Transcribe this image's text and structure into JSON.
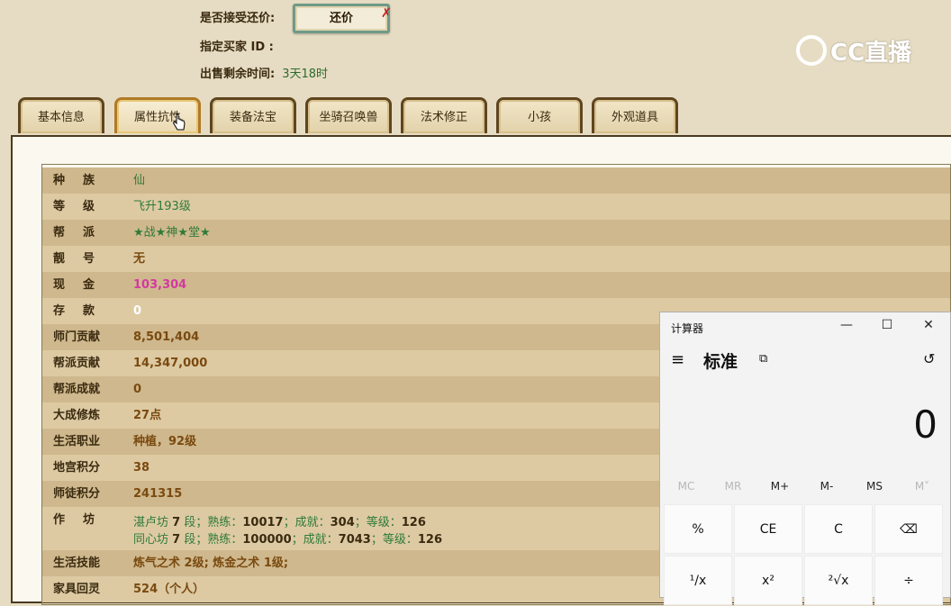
{
  "header": {
    "accept_counter_label": "是否接受还价:",
    "counter_button": "还价",
    "buyer_id_label": "指定买家 ID :",
    "time_left_label": "出售剩余时间:",
    "time_left_value": "3天18时"
  },
  "logo": {
    "text": "CC直播"
  },
  "tabs": [
    {
      "label": "基本信息"
    },
    {
      "label": "属性抗性"
    },
    {
      "label": "装备法宝"
    },
    {
      "label": "坐骑召唤兽"
    },
    {
      "label": "法术修正"
    },
    {
      "label": "小孩"
    },
    {
      "label": "外观道具"
    }
  ],
  "rows": [
    {
      "label": "种族",
      "value": "仙"
    },
    {
      "label": "等级",
      "value": "飞升193级"
    },
    {
      "label": "帮派",
      "value": "★战★神★堂★"
    },
    {
      "label": "靓号",
      "value": "无"
    },
    {
      "label": "现金",
      "value": "103,304"
    },
    {
      "label": "存款",
      "value": "0"
    },
    {
      "label": "师门贡献",
      "value": "8,501,404"
    },
    {
      "label": "帮派贡献",
      "value": "14,347,000"
    },
    {
      "label": "帮派成就",
      "value": "0"
    },
    {
      "label": "大成修炼",
      "value": "27点"
    },
    {
      "label": "生活职业",
      "value": "种植，92级"
    },
    {
      "label": "地宫积分",
      "value": "38"
    },
    {
      "label": "师徒积分",
      "value": "241315"
    },
    {
      "label": "作坊",
      "workshops": [
        {
          "name": "湛卢坊",
          "level": "7",
          "seg": "段；熟练：",
          "skill": "10017",
          "ach_label": "；成就：",
          "ach": "304",
          "grade_label": "；等级：",
          "grade": "126"
        },
        {
          "name": "同心坊",
          "level": "7",
          "seg": "段；熟练：",
          "skill": "100000",
          "ach_label": "；成就：",
          "ach": "7043",
          "grade_label": "；等级：",
          "grade": "126"
        }
      ]
    },
    {
      "label": "生活技能",
      "value": "炼气之术 2级; 炼金之术 1级;"
    },
    {
      "label": "家具回灵",
      "value": "524（个人）"
    }
  ],
  "calculator": {
    "title": "计算器",
    "mode": "标准",
    "display": "0",
    "memory": [
      "MC",
      "MR",
      "M+",
      "M-",
      "MS",
      "M˅"
    ],
    "keys_row1": [
      "%",
      "CE",
      "C",
      "⌫"
    ],
    "keys_row2": [
      "¹/x",
      "x²",
      "²√x",
      "÷"
    ]
  }
}
